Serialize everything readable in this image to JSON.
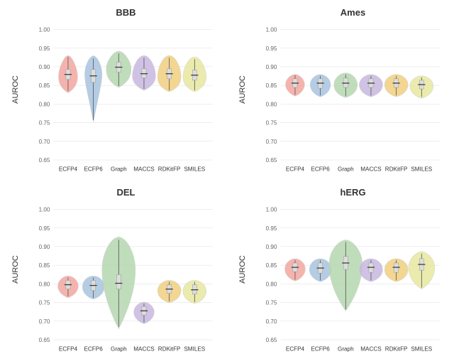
{
  "panels": [
    {
      "id": "bbb",
      "title": "BBB",
      "yLabel": "AUROC",
      "xLabels": [
        "ECFP4",
        "ECFP6",
        "Graph",
        "MACCS",
        "RDKitFP",
        "SMILES"
      ],
      "yMin": 0.65,
      "yMax": 1.0,
      "yTicks": [
        0.65,
        0.7,
        0.75,
        0.8,
        0.85,
        0.9,
        0.95,
        1.0
      ]
    },
    {
      "id": "ames",
      "title": "Ames",
      "yLabel": "AUROC",
      "xLabels": [
        "ECFP4",
        "ECFP6",
        "Graph",
        "MACCS",
        "RDKitFP",
        "SMILES"
      ],
      "yMin": 0.65,
      "yMax": 1.0,
      "yTicks": [
        0.65,
        0.7,
        0.75,
        0.8,
        0.85,
        0.9,
        0.95,
        1.0
      ]
    },
    {
      "id": "del",
      "title": "DEL",
      "yLabel": "AUROC",
      "xLabels": [
        "ECFP4",
        "ECFP6",
        "Graph",
        "MACCS",
        "RDKitFP",
        "SMILES"
      ],
      "yMin": 0.65,
      "yMax": 1.0,
      "yTicks": [
        0.65,
        0.7,
        0.75,
        0.8,
        0.85,
        0.9,
        0.95,
        1.0
      ]
    },
    {
      "id": "herg",
      "title": "hERG",
      "yLabel": "AUROC",
      "xLabels": [
        "ECFP4",
        "ECFP6",
        "Graph",
        "MACCS",
        "RDKitFP",
        "SMILES"
      ],
      "yMin": 0.65,
      "yMax": 1.0,
      "yTicks": [
        0.65,
        0.7,
        0.75,
        0.8,
        0.85,
        0.9,
        0.95,
        1.0
      ]
    }
  ]
}
